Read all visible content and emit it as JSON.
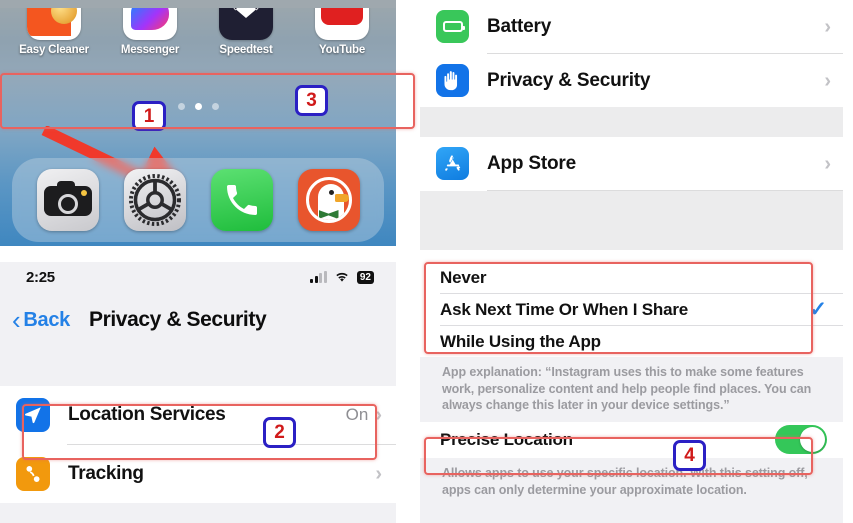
{
  "home": {
    "apps": [
      {
        "label": "Easy Cleaner",
        "icon": "easy-cleaner-icon"
      },
      {
        "label": "Messenger",
        "icon": "messenger-icon"
      },
      {
        "label": "Speedtest",
        "icon": "speedtest-icon"
      },
      {
        "label": "YouTube",
        "icon": "youtube-icon"
      }
    ],
    "page_dots": {
      "count": 3,
      "active_index": 1
    },
    "dock": [
      {
        "name": "camera-app-icon"
      },
      {
        "name": "settings-app-icon"
      },
      {
        "name": "phone-app-icon"
      },
      {
        "name": "duckduckgo-app-icon"
      }
    ],
    "callout_number": "1"
  },
  "settings": {
    "rows": [
      {
        "label": "Battery",
        "icon": "battery-icon",
        "value": "",
        "chevron": "›"
      },
      {
        "label": "Privacy & Security",
        "icon": "hand-privacy-icon",
        "value": "",
        "chevron": "›"
      },
      {
        "label": "App Store",
        "icon": "app-store-icon",
        "value": "",
        "chevron": "›"
      }
    ],
    "callout_number": "3"
  },
  "privacy": {
    "status_bar": {
      "time": "2:25",
      "battery": "92"
    },
    "nav": {
      "back_label": "Back",
      "title": "Privacy & Security"
    },
    "rows": [
      {
        "label": "Location Services",
        "icon": "location-arrow-icon",
        "value": "On",
        "chevron": "›"
      },
      {
        "label": "Tracking",
        "icon": "tracking-icon",
        "value": "",
        "chevron": "›"
      }
    ],
    "callout_number": "2"
  },
  "location": {
    "options": [
      {
        "label": "Never",
        "checked": false
      },
      {
        "label": "Ask Next Time Or When I Share",
        "checked": true
      },
      {
        "label": "While Using the App",
        "checked": false
      }
    ],
    "check_glyph": "✓",
    "app_explanation": "App explanation: “Instagram uses this to make some features work, personalize content and help people find places. You can always change this later in your device settings.”",
    "precise_label": "Precise Location",
    "precise_enabled": true,
    "precise_explanation": "Allows apps to use your specific location. With this setting off, apps can only determine your approximate location.",
    "callout_number": "4"
  },
  "colors": {
    "highlight_red": "#e8635f",
    "badge_border_blue": "#2b20c4",
    "badge_text_red": "#d01a1a",
    "ios_blue": "#2481e6",
    "toggle_green": "#34c759",
    "arrow_red": "#f0392b"
  }
}
